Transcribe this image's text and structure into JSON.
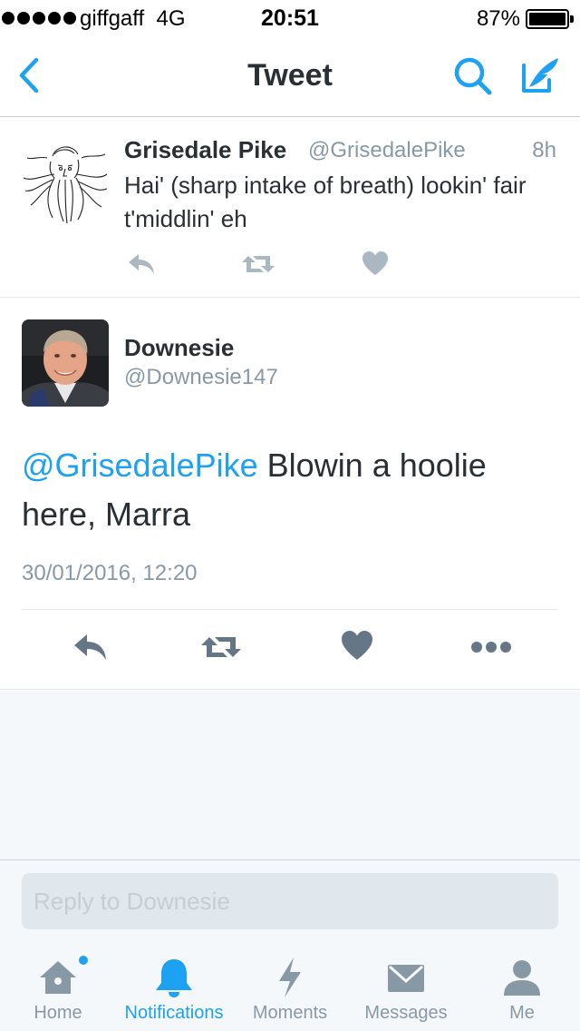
{
  "status_bar": {
    "carrier": "giffgaff",
    "network": "4G",
    "time": "20:51",
    "battery": "87%"
  },
  "nav": {
    "title": "Tweet",
    "back_icon": "chevron-left-icon",
    "search_icon": "search-icon",
    "compose_icon": "compose-icon"
  },
  "parent_tweet": {
    "name": "Grisedale Pike",
    "handle": "@GrisedalePike",
    "time_ago": "8h",
    "text": "Hai' (sharp intake of breath) lookin' fair t'middlin' eh"
  },
  "main_tweet": {
    "name": "Downesie",
    "handle": "@Downesie147",
    "mention": "@GrisedalePike",
    "text": " Blowin a hoolie here, Marra",
    "date": "30/01/2016, 12:20"
  },
  "reply": {
    "placeholder": "Reply to Downesie"
  },
  "tabs": [
    {
      "label": "Home",
      "icon": "home-icon",
      "active": false
    },
    {
      "label": "Notifications",
      "icon": "bell-icon",
      "active": true
    },
    {
      "label": "Moments",
      "icon": "lightning-icon",
      "active": false
    },
    {
      "label": "Messages",
      "icon": "envelope-icon",
      "active": false
    },
    {
      "label": "Me",
      "icon": "person-icon",
      "active": false
    }
  ],
  "colors": {
    "accent": "#1da1f2",
    "icon_gray": "#8899a6",
    "action_gray": "#aab8c2",
    "action_dark": "#657786",
    "text": "#292f33",
    "background_light": "#f5f8fa"
  }
}
